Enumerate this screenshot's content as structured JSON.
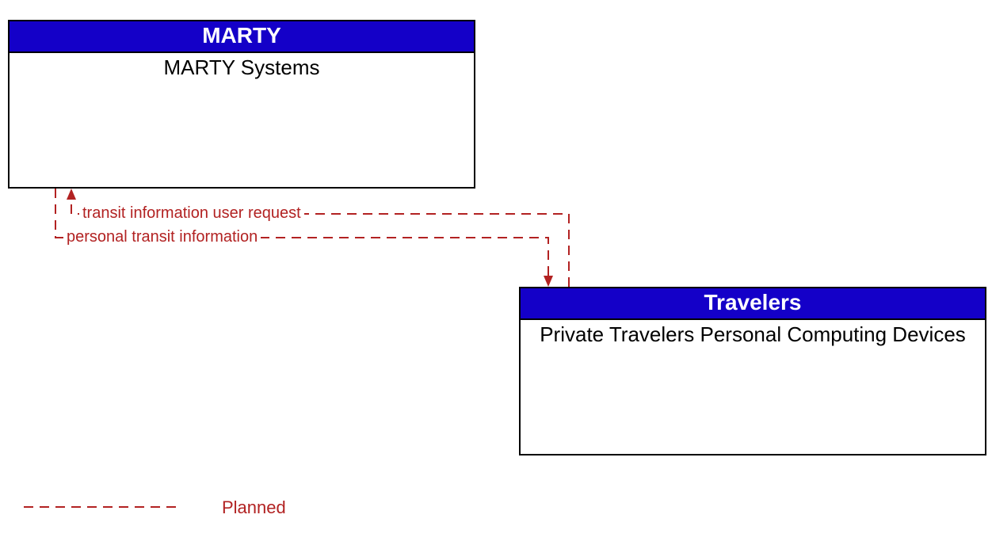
{
  "entities": {
    "marty": {
      "header": "MARTY",
      "body": "MARTY Systems"
    },
    "travelers": {
      "header": "Travelers",
      "body": "Private Travelers Personal Computing Devices"
    }
  },
  "flows": {
    "request": "transit information user request",
    "info": "personal transit information"
  },
  "legend": {
    "planned": "Planned"
  },
  "colors": {
    "header_bg": "#1400c8",
    "flow_color": "#b22222"
  }
}
